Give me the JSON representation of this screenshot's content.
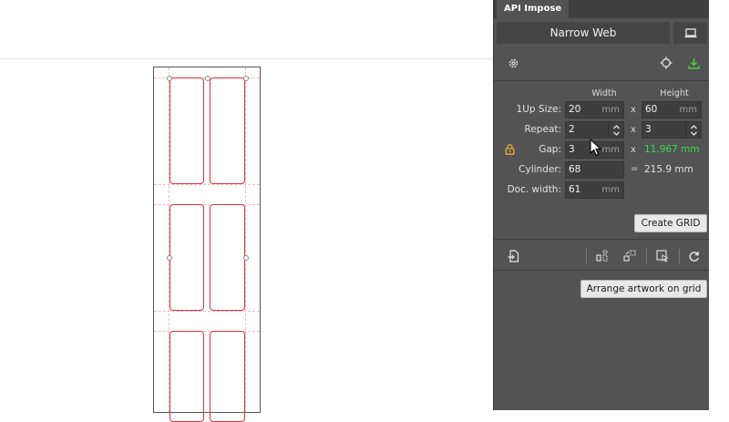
{
  "panel": {
    "tab_title": "API Impose",
    "mode": "Narrow Web",
    "columns": {
      "width": "Width",
      "height": "Height"
    },
    "rows": {
      "up_size": {
        "label": "1Up Size:",
        "width": "20",
        "width_unit": "mm",
        "op": "x",
        "height": "60",
        "height_unit": "mm"
      },
      "repeat": {
        "label": "Repeat:",
        "across": "2",
        "op": "x",
        "around": "3"
      },
      "gap": {
        "label": "Gap:",
        "width": "3",
        "width_unit": "mm",
        "op": "x",
        "computed": "11.967 mm"
      },
      "cylinder": {
        "label": "Cylinder:",
        "value": "68",
        "op": "=",
        "result": "215.9 mm"
      },
      "doc_width": {
        "label": "Doc. width:",
        "value": "61",
        "unit": "mm"
      }
    },
    "create_grid_label": "Create GRID",
    "arrange_label": "Arrange artwork on grid"
  },
  "colors": {
    "panel_bg": "#535353",
    "field_bg": "#3e3e3e",
    "computed_green": "#3ad84f",
    "lock_yellow": "#e1b333",
    "grid_red": "#e0303f",
    "export_green": "#4cc94c"
  }
}
